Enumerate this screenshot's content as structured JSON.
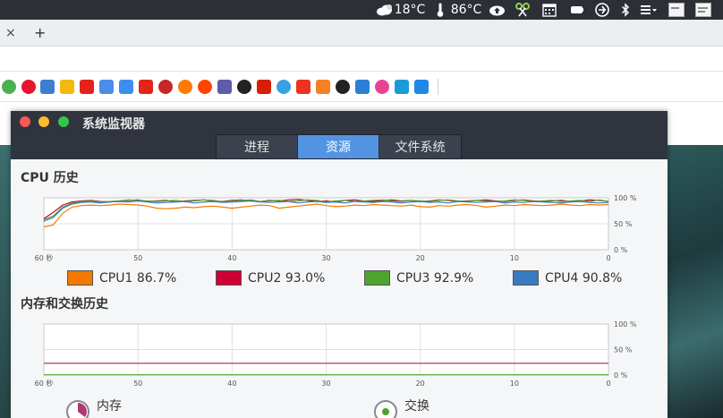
{
  "system_bar": {
    "temp_outdoor": "18°C",
    "temp_cpu": "86°C"
  },
  "browser": {
    "tab_close": "×",
    "new_tab": "+"
  },
  "colors": {
    "cpu1": "#f57900",
    "cpu2": "#cc0033",
    "cpu3": "#4ca42b",
    "cpu4": "#3a7bbf",
    "memory": "#ad3973",
    "swap": "#4ca42b",
    "active_tab": "#5294e2"
  },
  "window": {
    "title": "系统监视器",
    "tabs": [
      {
        "label": "进程",
        "active": false
      },
      {
        "label": "资源",
        "active": true
      },
      {
        "label": "文件系统",
        "active": false
      }
    ]
  },
  "cpu_section": {
    "title": "CPU 历史",
    "legend": [
      {
        "label": "CPU1",
        "value": "86.7%"
      },
      {
        "label": "CPU2",
        "value": "93.0%"
      },
      {
        "label": "CPU3",
        "value": "92.9%"
      },
      {
        "label": "CPU4",
        "value": "90.8%"
      }
    ]
  },
  "memory_section": {
    "title": "内存和交换历史",
    "memory_label": "内存",
    "swap_label": "交换"
  },
  "chart_data": [
    {
      "type": "line",
      "x_ticks": [
        "60 秒",
        "50",
        "40",
        "30",
        "20",
        "10",
        "0"
      ],
      "y_ticks": [
        "100 %",
        "50 %",
        "0 %"
      ],
      "xlim": [
        60,
        0
      ],
      "ylim": [
        0,
        100
      ],
      "grid": true,
      "x": [
        60,
        59,
        58,
        57,
        56,
        55,
        54,
        53,
        52,
        51,
        50,
        49,
        48,
        47,
        46,
        45,
        44,
        43,
        42,
        41,
        40,
        39,
        38,
        37,
        36,
        35,
        34,
        33,
        32,
        31,
        30,
        29,
        28,
        27,
        26,
        25,
        24,
        23,
        22,
        21,
        20,
        19,
        18,
        17,
        16,
        15,
        14,
        13,
        12,
        11,
        10,
        9,
        8,
        7,
        6,
        5,
        4,
        3,
        2,
        1,
        0
      ],
      "series": [
        {
          "name": "CPU1",
          "values": [
            44,
            48,
            70,
            82,
            85,
            86,
            85,
            86,
            88,
            87,
            86,
            84,
            80,
            79,
            80,
            82,
            81,
            83,
            84,
            82,
            80,
            82,
            84,
            86,
            85,
            80,
            82,
            84,
            86,
            88,
            85,
            83,
            84,
            86,
            85,
            87,
            86,
            85,
            84,
            86,
            83,
            82,
            85,
            84,
            86,
            87,
            85,
            82,
            84,
            86,
            85,
            87,
            86,
            85,
            86,
            88,
            86,
            85,
            87,
            86,
            87
          ]
        },
        {
          "name": "CPU2",
          "values": [
            60,
            72,
            86,
            92,
            94,
            95,
            93,
            92,
            94,
            95,
            96,
            93,
            94,
            95,
            92,
            94,
            95,
            96,
            94,
            93,
            95,
            96,
            94,
            93,
            95,
            94,
            96,
            97,
            95,
            93,
            94,
            92,
            95,
            96,
            94,
            93,
            95,
            96,
            94,
            95,
            93,
            94,
            96,
            95,
            93,
            94,
            95,
            96,
            94,
            93,
            95,
            96,
            94,
            93,
            94,
            95,
            93,
            94,
            96,
            95,
            93
          ]
        },
        {
          "name": "CPU3",
          "values": [
            58,
            65,
            82,
            90,
            93,
            94,
            92,
            93,
            94,
            96,
            95,
            94,
            93,
            94,
            95,
            93,
            94,
            96,
            95,
            92,
            94,
            95,
            96,
            93,
            94,
            95,
            93,
            94,
            96,
            95,
            92,
            94,
            95,
            93,
            94,
            95,
            96,
            94,
            93,
            95,
            94,
            93,
            95,
            96,
            94,
            93,
            95,
            94,
            93,
            94,
            96,
            95,
            93,
            94,
            95,
            93,
            94,
            95,
            93,
            96,
            93
          ]
        },
        {
          "name": "CPU4",
          "values": [
            55,
            62,
            80,
            88,
            91,
            92,
            90,
            92,
            93,
            92,
            94,
            92,
            90,
            91,
            92,
            93,
            90,
            92,
            93,
            91,
            92,
            93,
            94,
            92,
            91,
            92,
            93,
            90,
            92,
            93,
            91,
            92,
            90,
            93,
            92,
            91,
            93,
            92,
            90,
            92,
            93,
            91,
            92,
            90,
            93,
            92,
            91,
            92,
            93,
            90,
            92,
            91,
            93,
            92,
            91,
            90,
            92,
            93,
            91,
            90,
            91
          ]
        }
      ]
    },
    {
      "type": "line",
      "x_ticks": [
        "60 秒",
        "50",
        "40",
        "30",
        "20",
        "10",
        "0"
      ],
      "y_ticks": [
        "100 %",
        "50 %",
        "0 %"
      ],
      "xlim": [
        60,
        0
      ],
      "ylim": [
        0,
        100
      ],
      "grid": true,
      "x": [
        60,
        0
      ],
      "series": [
        {
          "name": "内存",
          "values": [
            23,
            23
          ]
        },
        {
          "name": "交换",
          "values": [
            0.5,
            0.5
          ]
        }
      ]
    }
  ]
}
